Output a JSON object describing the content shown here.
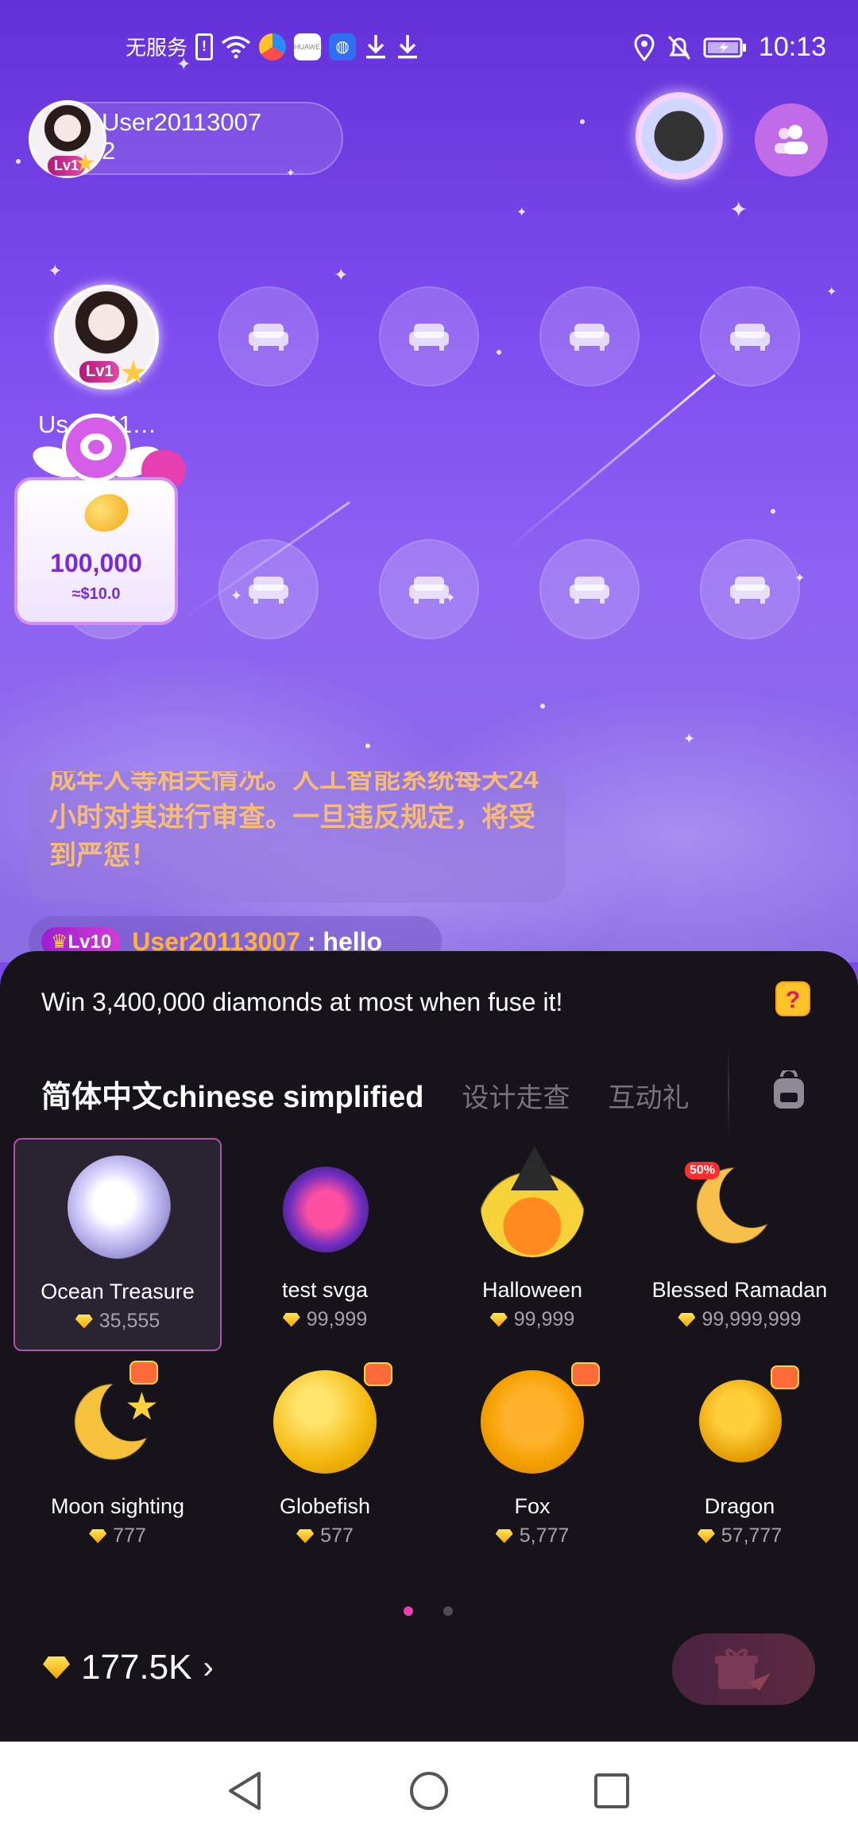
{
  "status_bar": {
    "carrier": "无服务",
    "time": "10:13",
    "left_icons": [
      "sim-alert-icon",
      "wifi-icon",
      "browser-icon",
      "huawei-app-icon",
      "globe-app-icon",
      "download-icon",
      "download-icon"
    ],
    "right_icons": [
      "location-icon",
      "bell-off-icon",
      "battery-charging-icon"
    ]
  },
  "host": {
    "name": "User20113007\n2",
    "level": "Lv1"
  },
  "seats": {
    "occupied_name": "Us…011…",
    "occupied_level": "Lv1",
    "empty_seat_icon": "sofa-icon"
  },
  "coin_popup": {
    "amount": "100,000",
    "usd": "≈$10.0"
  },
  "notice": {
    "text": "成年人等相关情况。人工智能系统每天24 小时对其进行审查。一旦违反规定，将受到严惩！"
  },
  "chat": {
    "level": "Lv10",
    "user": "User20113007",
    "separator": " : ",
    "message": "hello"
  },
  "gift_panel": {
    "promo": "Win 3,400,000 diamonds at most when fuse it!",
    "help_label": "?",
    "tabs": [
      {
        "label": "简体中文chinese simplified",
        "active": true
      },
      {
        "label": "设计走查",
        "active": false
      },
      {
        "label": "互动礼",
        "active": false
      }
    ],
    "gifts": [
      {
        "name": "Ocean Treasure",
        "price": "35,555",
        "selected": true
      },
      {
        "name": "test svga",
        "price": "99,999"
      },
      {
        "name": "Halloween",
        "price": "99,999"
      },
      {
        "name": "Blessed Ramadan",
        "price": "99,999,999",
        "badge": "50%"
      },
      {
        "name": "Moon sighting",
        "price": "777"
      },
      {
        "name": "Globefish",
        "price": "577"
      },
      {
        "name": "Fox",
        "price": "5,777"
      },
      {
        "name": "Dragon",
        "price": "57,777"
      }
    ],
    "page_count": 2,
    "current_page": 1,
    "balance": "177.5K"
  },
  "nav": {
    "back": "back-triangle-icon",
    "home": "home-circle-icon",
    "recents": "recents-square-icon"
  },
  "colors": {
    "accent_pink": "#e63fb0",
    "panel_bg": "#16141a",
    "gold": "#ffc429",
    "notice_text": "#ffc46a"
  }
}
